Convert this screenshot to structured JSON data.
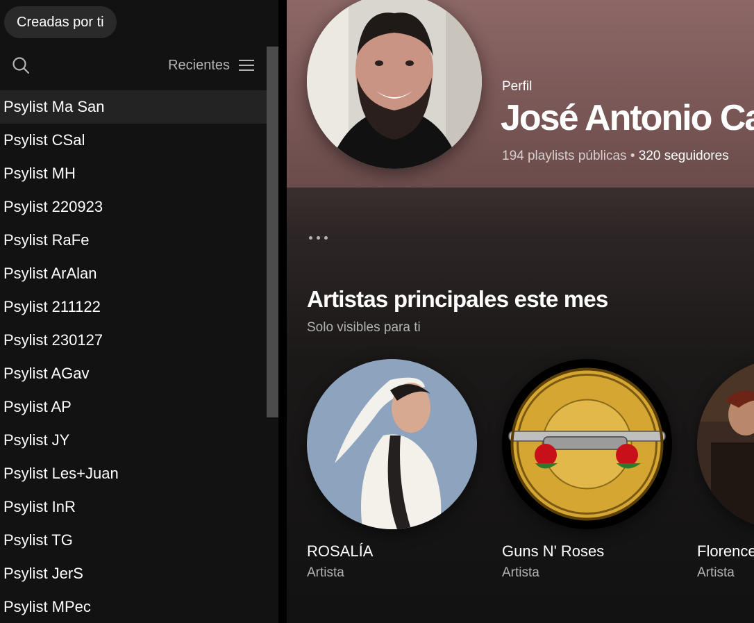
{
  "sidebar": {
    "filter_chip": "Creadas por ti",
    "sort_label": "Recientes",
    "icons": {
      "search": "search-icon",
      "list": "list-icon"
    },
    "playlists": [
      "Psylist Ma San",
      "Psylist CSal",
      "Psylist MH",
      "Psylist 220923",
      "Psylist RaFe",
      "Psylist ArAlan",
      "Psylist 211122",
      "Psylist 230127",
      "Psylist AGav",
      "Psylist AP",
      "Psylist JY",
      "Psylist Les+Juan",
      "Psylist InR",
      "Psylist TG",
      "Psylist JerS",
      "Psylist MPec"
    ]
  },
  "profile": {
    "type_label": "Perfil",
    "name": "José Antonio Cas",
    "public_playlists": "194 playlists públicas",
    "separator": "•",
    "followers": "320 seguidores"
  },
  "section": {
    "title": "Artistas principales este mes",
    "subtitle": "Solo visibles para ti"
  },
  "artists": [
    {
      "name": "ROSALÍA",
      "role": "Artista"
    },
    {
      "name": "Guns N' Roses",
      "role": "Artista"
    },
    {
      "name": "Florence + The Machine",
      "role": "Artista"
    }
  ],
  "colors": {
    "sidebar_bg": "#121212",
    "header_bg": "#8c6766",
    "text_secondary": "#b3b3b3"
  }
}
